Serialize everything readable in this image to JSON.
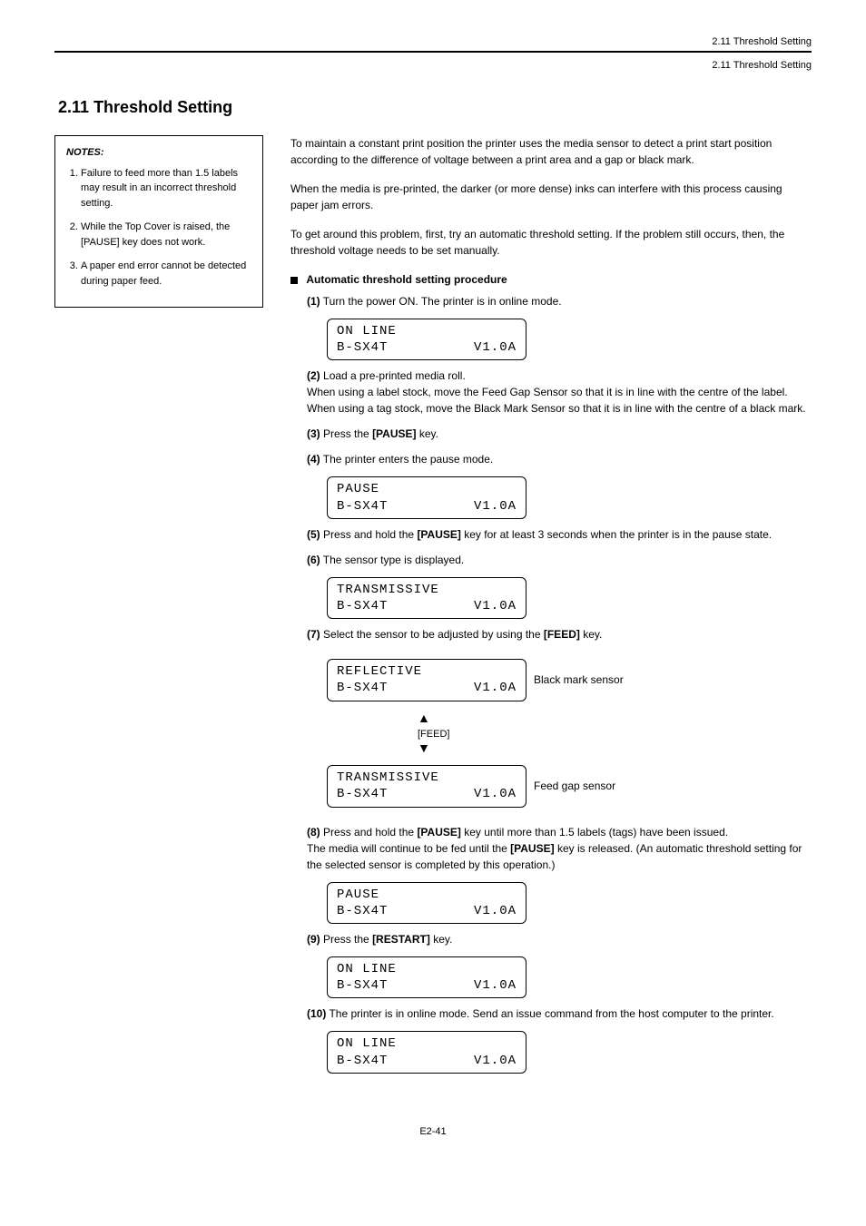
{
  "header": "2.11 Threshold Setting",
  "page_label": "E2-41",
  "section": {
    "number": "2.11",
    "title": "Threshold Setting"
  },
  "notes_title": "NOTES:",
  "notes": [
    "Failure to feed more than 1.5 labels may result in an incorrect threshold setting.",
    "While the Top Cover is raised, the [PAUSE] key does not work.",
    "A paper end error cannot be detected during paper feed."
  ],
  "intro": [
    "To maintain a constant print position the printer uses the media sensor to detect a print start position according to the difference of voltage between a print area and a gap or black mark.",
    "When the media is pre-printed, the darker (or more dense) inks can interfere with this process causing paper jam errors.",
    "To get around this problem, first, try an automatic threshold setting. If the problem still occurs, then, the threshold voltage needs to be set manually."
  ],
  "procedure_title": "Automatic threshold setting procedure",
  "steps": {
    "s1": "Turn the power ON. The printer is in online mode.",
    "s2_a": "Load a pre-printed media roll.",
    "s2_b": "When using a label stock, move the Feed Gap Sensor so that it is in line with the centre of the label.",
    "s2_c": "When using a tag stock, move the Black Mark Sensor so that it is in line with the centre of a black mark.",
    "s3": "Press the",
    "s3_key": "[PAUSE]",
    "s3_b": "key.",
    "s4": "The printer enters the pause mode.",
    "s5a": "Press and hold the",
    "s5b": "key for at least 3 seconds when the printer is in the pause state.",
    "s6": "The sensor type is displayed.",
    "s7a": "Select the sensor to be adjusted by using the",
    "s7b": "key.",
    "s8a": "Press and hold the",
    "s8b": "key until more than 1.5 labels (tags) have been issued.",
    "s8c": "The media will continue to be fed until the",
    "s8d": "key is released.",
    "s8e": "(An automatic threshold setting for the selected sensor is completed by this operation.)",
    "s9a": "Press the",
    "s9b": "key.",
    "s10": "The printer is in online mode. Send an issue command from the host computer to the printer."
  },
  "sensors": {
    "reflective": "Black mark sensor",
    "transmissive": "Feed gap sensor"
  },
  "keys": {
    "pause": "[PAUSE]",
    "feed": "[FEED]",
    "restart": "[RESTART]"
  },
  "lcd": {
    "online1": "ON LINE",
    "model": "B-SX4T",
    "ver": "V1.0A",
    "pause": "PAUSE",
    "transmissive": "TRANSMISSIVE",
    "reflective": "REFLECTIVE"
  }
}
